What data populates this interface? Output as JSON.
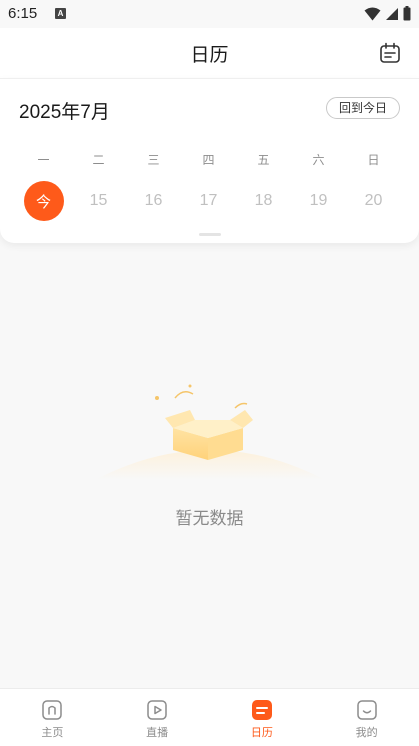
{
  "status_bar": {
    "time": "6:15",
    "notification_icon_letter": "A",
    "icons": [
      "wifi-icon",
      "cell-signal-icon",
      "battery-icon"
    ]
  },
  "header": {
    "title": "日历",
    "icon": "calendar-icon"
  },
  "calendar": {
    "month_title": "2025年7月",
    "back_today_label": "回到今日",
    "weekdays": [
      "一",
      "二",
      "三",
      "四",
      "五",
      "六",
      "日"
    ],
    "today_label": "今",
    "days": [
      "15",
      "16",
      "17",
      "18",
      "19",
      "20"
    ]
  },
  "empty_state": {
    "icon": "empty-box-illustration",
    "message": "暂无数据"
  },
  "tabbar": {
    "items": [
      {
        "label": "主页",
        "icon": "home-icon",
        "active": false
      },
      {
        "label": "直播",
        "icon": "play-icon",
        "active": false
      },
      {
        "label": "日历",
        "icon": "calendar-list-icon",
        "active": true
      },
      {
        "label": "我的",
        "icon": "smile-icon",
        "active": false
      }
    ]
  },
  "colors": {
    "accent": "#fe5a1a",
    "background": "#f8f8f8",
    "muted_text": "#8a8a8a"
  }
}
